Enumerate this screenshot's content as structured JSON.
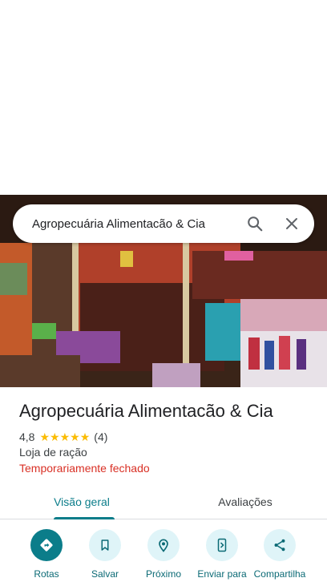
{
  "search": {
    "query": "Agropecuária Alimentacão & Cia",
    "search_icon": "search-icon",
    "close_icon": "close-icon"
  },
  "place": {
    "name": "Agropecuária Alimentacão & Cia",
    "rating": "4,8",
    "stars": 5,
    "review_count": "(4)",
    "category": "Loja de ração",
    "status": "Temporariamente fechado"
  },
  "tabs": [
    {
      "label": "Visão geral",
      "active": true
    },
    {
      "label": "Avaliações",
      "active": false
    }
  ],
  "actions": [
    {
      "label": "Rotas",
      "icon": "directions-icon"
    },
    {
      "label": "Salvar",
      "icon": "bookmark-icon"
    },
    {
      "label": "Próximo",
      "icon": "nearby-icon"
    },
    {
      "label": "Enviar para",
      "icon": "send-to-phone-icon"
    },
    {
      "label": "Compartilha",
      "icon": "share-icon"
    }
  ],
  "colors": {
    "accent": "#0b7d8a",
    "closed": "#d93025",
    "star": "#fbbc04",
    "action_bg": "#dff4f8"
  }
}
